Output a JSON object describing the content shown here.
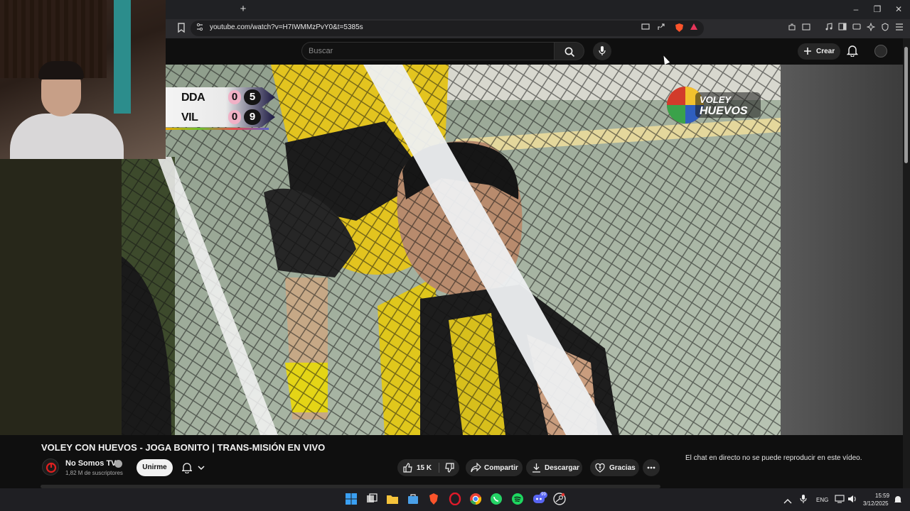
{
  "browser": {
    "url": "youtube.com/watch?v=H7IWMMzPvY0&t=5385s",
    "new_tab_label": "+",
    "window": {
      "minimize": "–",
      "restore": "❐",
      "close": "✕"
    }
  },
  "header": {
    "search_placeholder": "Buscar",
    "create_label": "Crear"
  },
  "video": {
    "scoreboard": [
      {
        "team": "DDA",
        "sets": "0",
        "points": "5"
      },
      {
        "team": "VIL",
        "sets": "0",
        "points": "9"
      }
    ],
    "logo_text": "VOLEY con HUEVOS"
  },
  "meta": {
    "title": "VOLEY CON HUEVOS - JOGA BONITO | TRANS-MISIÓN EN VIVO",
    "channel_name": "No Somos TV",
    "subscribers": "1,82 M de suscriptores",
    "join_label": "Unirme",
    "likes": "15 K",
    "share_label": "Compartir",
    "download_label": "Descargar",
    "thanks_label": "Gracias",
    "chat_message": "El chat en directo no se puede reproducir en este vídeo."
  },
  "taskbar": {
    "lang": "ENG",
    "time": "15:59",
    "date": "3/12/2025",
    "discord_badge": "99"
  },
  "colors": {
    "page_bg": "#0f0f0f",
    "chrome_bg": "#2b2b2e",
    "pill_bg": "#272727",
    "brave_orange": "#fb542b"
  }
}
